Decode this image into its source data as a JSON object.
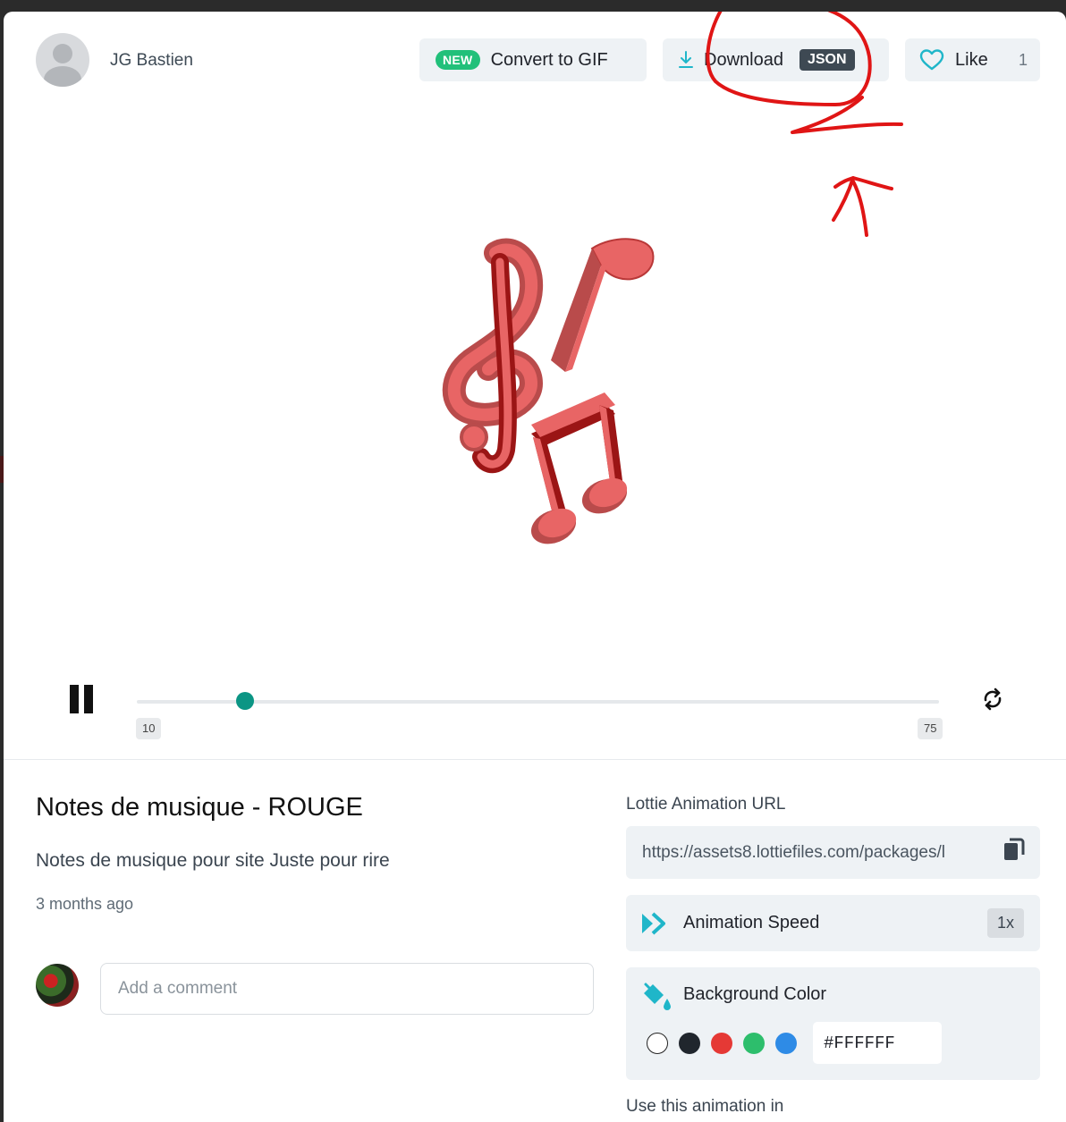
{
  "header": {
    "author": "JG Bastien",
    "convert": {
      "badge": "NEW",
      "label": "Convert to GIF"
    },
    "download": {
      "label": "Download",
      "badge": "JSON"
    },
    "like": {
      "label": "Like",
      "count": "1"
    }
  },
  "player": {
    "start_frame": "10",
    "end_frame": "75",
    "progress": 0.135
  },
  "details": {
    "title": "Notes de musique - ROUGE",
    "description": "Notes de musique pour site Juste pour rire",
    "time_ago": "3 months ago",
    "comment_placeholder": "Add a comment"
  },
  "sidebar": {
    "url_label": "Lottie Animation URL",
    "url": "https://assets8.lottiefiles.com/packages/l",
    "speed_label": "Animation Speed",
    "speed_value": "1x",
    "bg_label": "Background Color",
    "bg_swatches": [
      "#FFFFFF",
      "#20262D",
      "#E53935",
      "#2DBE6C",
      "#2E8BE6"
    ],
    "bg_hex": "#FFFFFF",
    "use_in_label": "Use this animation in"
  },
  "colors": {
    "accent_teal": "#0B9584",
    "new_badge": "#21C07A",
    "annotation_red": "#E01515",
    "note_light": "#E86565",
    "note_dark": "#9B1515"
  }
}
